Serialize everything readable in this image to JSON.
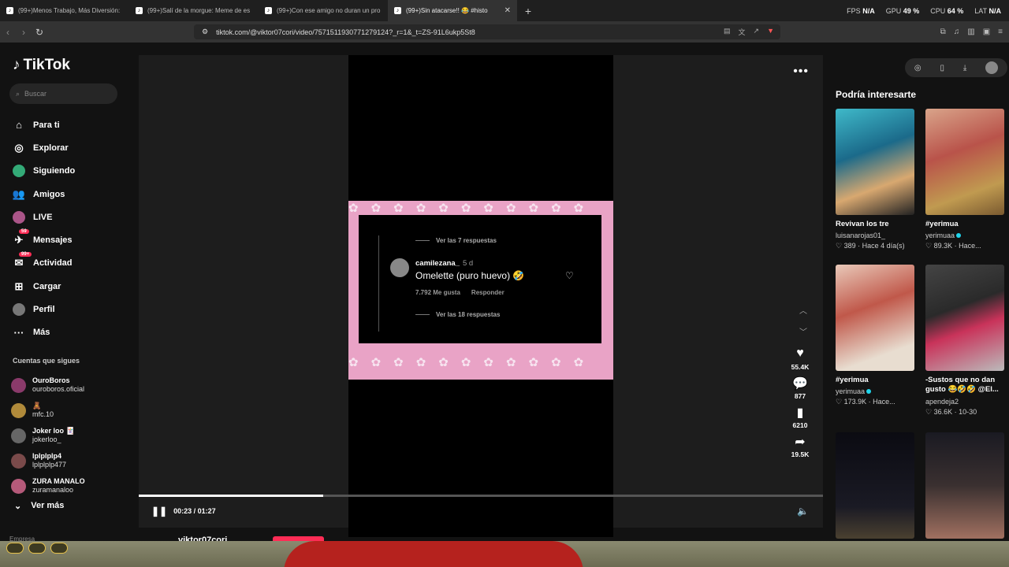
{
  "browser": {
    "tabs": [
      {
        "title": "(99+)Menos Trabajo, Más Diversión:"
      },
      {
        "title": "(99+)Salí de la morgue: Meme de es"
      },
      {
        "title": "(99+)Con ese amigo no duran un pro"
      },
      {
        "title": "(99+)Sin atacarse!! 😂 #histo",
        "active": true
      }
    ],
    "stats": {
      "fps_label": "FPS",
      "fps_value": "N/A",
      "gpu_label": "GPU",
      "gpu_value": "49 %",
      "cpu_label": "CPU",
      "cpu_value": "64 %",
      "lat_label": "LAT",
      "lat_value": "N/A"
    },
    "url": "tiktok.com/@viktor07cori/video/7571511930771279124?_r=1&_t=ZS-91L6ukp5St8"
  },
  "sidebar": {
    "logo": "TikTok",
    "search_placeholder": "Buscar",
    "nav": [
      {
        "label": "Para ti",
        "icon": "home-icon"
      },
      {
        "label": "Explorar",
        "icon": "compass-icon"
      },
      {
        "label": "Siguiendo",
        "icon": "following-icon"
      },
      {
        "label": "Amigos",
        "icon": "friends-icon"
      },
      {
        "label": "LIVE",
        "icon": "live-icon"
      },
      {
        "label": "Mensajes",
        "icon": "messages-icon",
        "badge": "59"
      },
      {
        "label": "Actividad",
        "icon": "activity-icon",
        "badge": "99+"
      },
      {
        "label": "Cargar",
        "icon": "upload-icon"
      },
      {
        "label": "Perfil",
        "icon": "profile-icon"
      },
      {
        "label": "Más",
        "icon": "more-icon"
      }
    ],
    "following_heading": "Cuentas que sigues",
    "following": [
      {
        "name": "OuroBoros",
        "user": "ouroboros.oficial"
      },
      {
        "name": "🧸",
        "user": "mfc.10"
      },
      {
        "name": "Joker loo 🃏",
        "user": "jokerloo_"
      },
      {
        "name": "lplplplp4",
        "user": "lplplplp477"
      },
      {
        "name": "ZURA MANALO",
        "user": "zuramanaloo"
      }
    ],
    "see_more": "Ver más",
    "company": "Empresa"
  },
  "video": {
    "comment": {
      "view_replies_top": "Ver las 7 respuestas",
      "username": "camilezana_",
      "age": "5 d",
      "text": "Omelette (puro huevo) 🤣",
      "likes": "7.792 Me gusta",
      "reply": "Responder",
      "view_replies_bottom": "Ver las 18 respuestas"
    },
    "likes": "55.4K",
    "comments": "877",
    "saves": "6210",
    "shares": "19.5K",
    "time": "00:23 / 01:27",
    "progress_fraction": 0.27,
    "author": "viktor07cori"
  },
  "suggestions": {
    "title": "Podría interesarte",
    "cards": [
      {
        "title": "Revivan los tre",
        "user": "luisanarojas01_",
        "stats": "389 · Hace 4 día(s)",
        "verified": false
      },
      {
        "title": "#yerimua",
        "user": "yerimuaa",
        "stats": "89.3K · Hace...",
        "verified": true
      },
      {
        "title": "#yerimua",
        "user": "yerimuaa",
        "stats": "173.9K · Hace...",
        "verified": true
      },
      {
        "title": "-Sustos que no dan gusto 😂🤣🤣 @El...",
        "user": "apendeja2",
        "stats": "36.6K · 10-30",
        "verified": false
      },
      {
        "title": "",
        "user": "",
        "stats": ""
      },
      {
        "title": "",
        "user": "",
        "stats": ""
      }
    ]
  },
  "colors": {
    "accent": "#fe2c55",
    "bg": "#121212"
  }
}
